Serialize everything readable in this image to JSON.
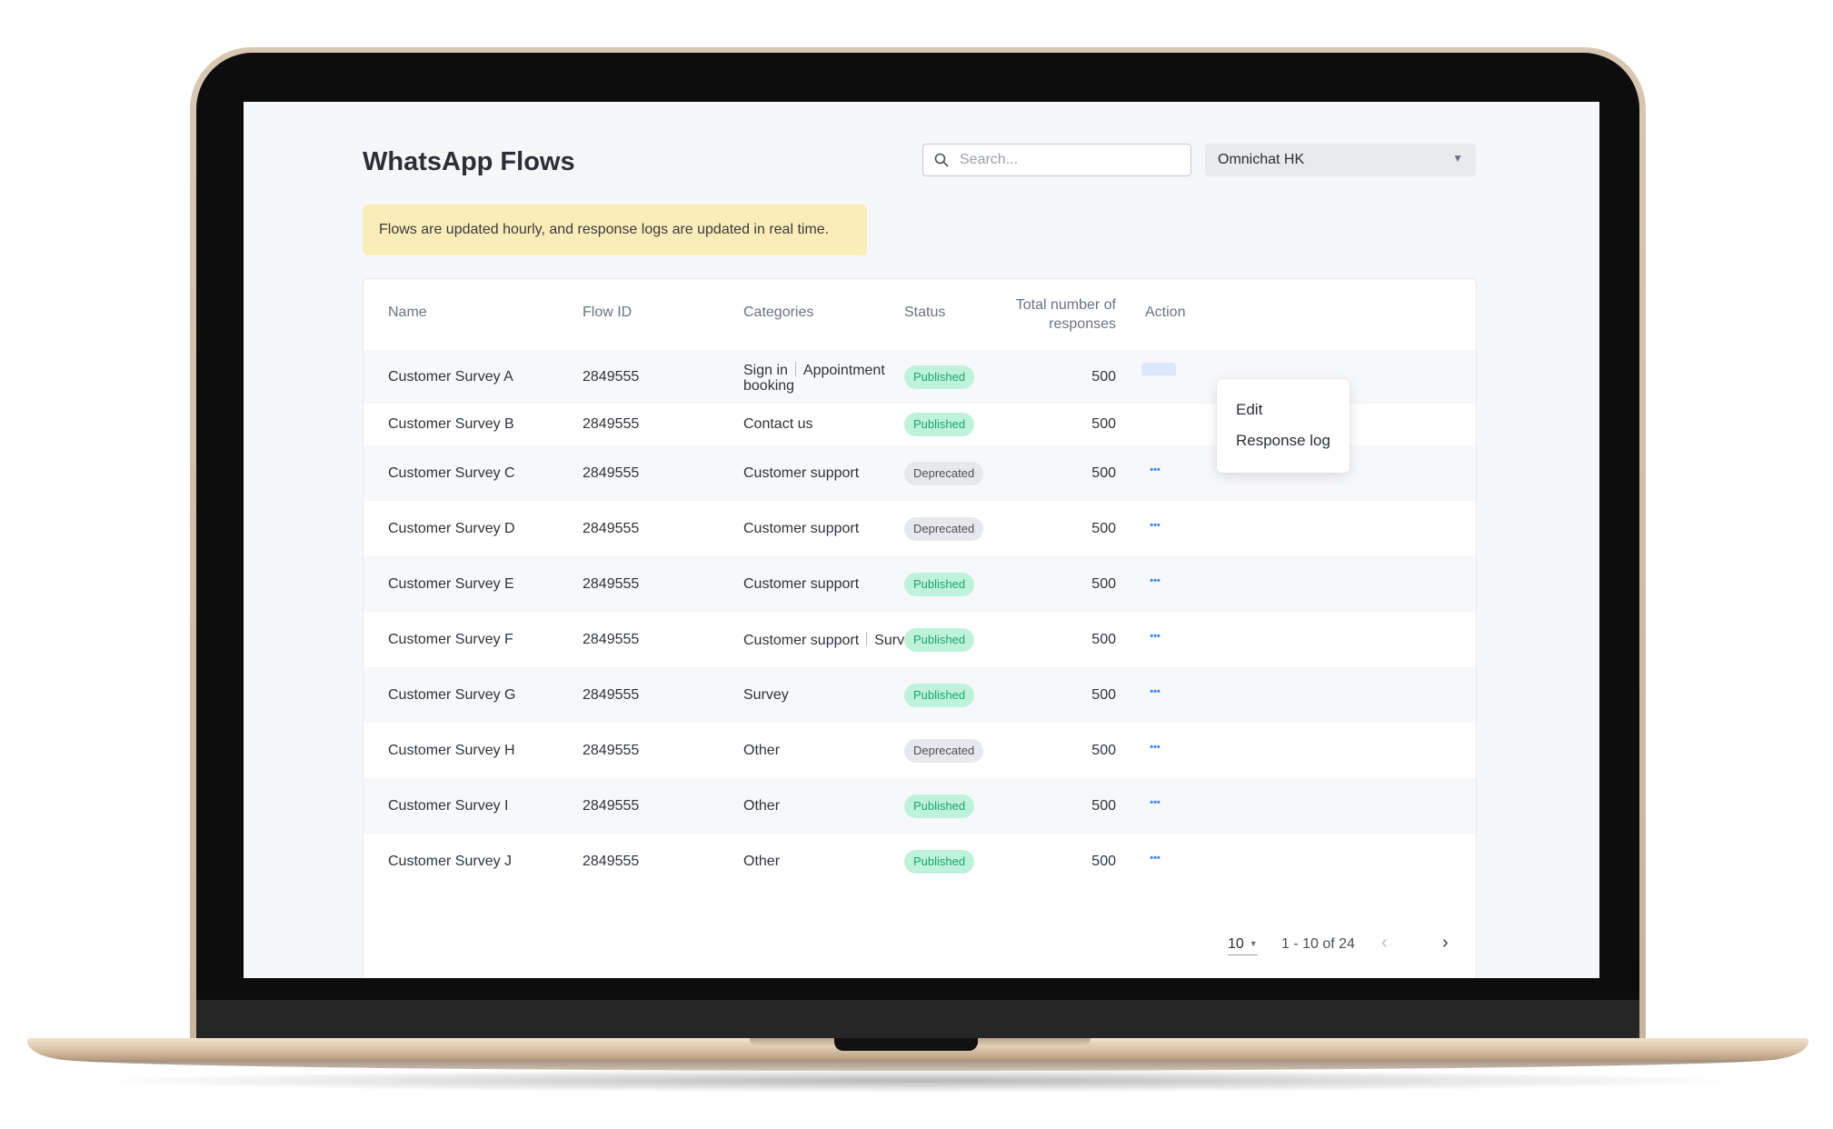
{
  "page": {
    "title": "WhatsApp Flows",
    "search_placeholder": "Search...",
    "account_select": "Omnichat HK",
    "banner": "Flows are updated hourly, and response logs are updated in real time."
  },
  "table": {
    "columns": [
      "Name",
      "Flow ID",
      "Categories",
      "Status",
      "Total number of responses",
      "Action"
    ],
    "rows": [
      {
        "name": "Customer Survey A",
        "flow_id": "2849555",
        "categories": [
          "Sign in",
          "Appointment booking"
        ],
        "status": "Published",
        "total": "500"
      },
      {
        "name": "Customer Survey B",
        "flow_id": "2849555",
        "categories": [
          "Contact us"
        ],
        "status": "Published",
        "total": "500"
      },
      {
        "name": "Customer Survey C",
        "flow_id": "2849555",
        "categories": [
          "Customer support"
        ],
        "status": "Deprecated",
        "total": "500"
      },
      {
        "name": "Customer Survey D",
        "flow_id": "2849555",
        "categories": [
          "Customer support"
        ],
        "status": "Deprecated",
        "total": "500"
      },
      {
        "name": "Customer Survey E",
        "flow_id": "2849555",
        "categories": [
          "Customer support"
        ],
        "status": "Published",
        "total": "500"
      },
      {
        "name": "Customer Survey F",
        "flow_id": "2849555",
        "categories": [
          "Customer support",
          "Survey"
        ],
        "status": "Published",
        "total": "500"
      },
      {
        "name": "Customer Survey G",
        "flow_id": "2849555",
        "categories": [
          "Survey"
        ],
        "status": "Published",
        "total": "500"
      },
      {
        "name": "Customer Survey H",
        "flow_id": "2849555",
        "categories": [
          "Other"
        ],
        "status": "Deprecated",
        "total": "500"
      },
      {
        "name": "Customer Survey I",
        "flow_id": "2849555",
        "categories": [
          "Other"
        ],
        "status": "Published",
        "total": "500"
      },
      {
        "name": "Customer Survey J",
        "flow_id": "2849555",
        "categories": [
          "Other"
        ],
        "status": "Published",
        "total": "500"
      }
    ]
  },
  "action_menu": {
    "open_row": 0,
    "items": [
      "Edit",
      "Response log"
    ],
    "more_icon": "more-horizontal-icon"
  },
  "pagination": {
    "page_size": "10",
    "range": "1 - 10 of  24",
    "prev_icon": "chevron-left-icon",
    "next_icon": "chevron-right-icon"
  },
  "colors": {
    "published_bg": "#bff2dc",
    "published_text": "#1aa76a",
    "deprecated_bg": "#e7e8eb",
    "accent": "#3b82f6",
    "banner_bg": "#fbedba"
  }
}
